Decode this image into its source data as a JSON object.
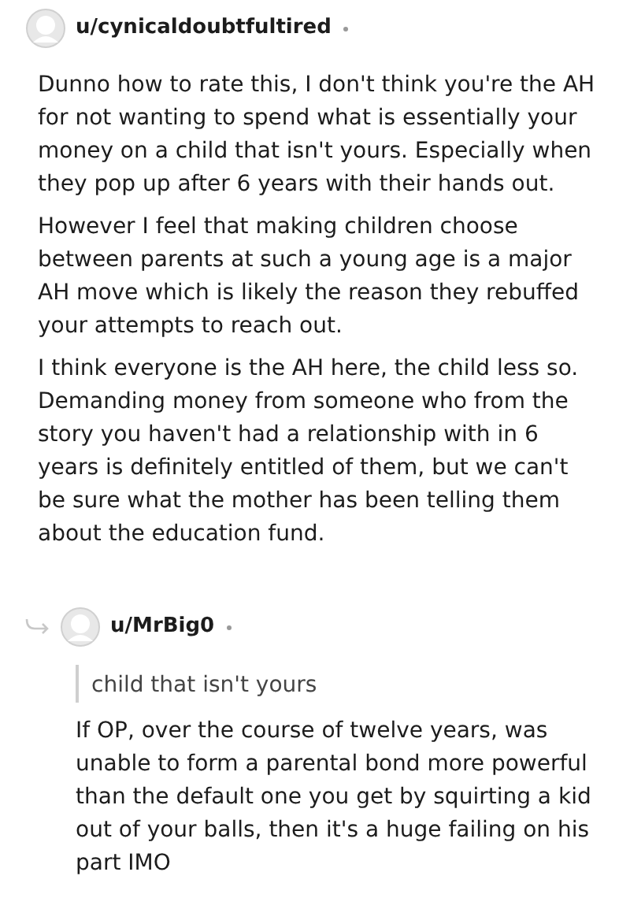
{
  "comment": {
    "author": "u/cynicaldoubtfultired",
    "paragraphs": [
      "Dunno how to rate this, I don't think you're the AH for not wanting to spend what is essentially your money on a child that isn't yours. Especially when they pop up after 6 years with their hands out.",
      "However I feel that making children choose between parents at such a young age is a major AH move which is likely the reason they rebuffed your attempts to reach out.",
      "I think everyone is the AH here, the child less so. Demanding money from someone who from the story you haven't had a relationship with in 6 years is definitely entitled of them, but we can't be sure what the mother has been telling them about the education fund."
    ]
  },
  "reply": {
    "author": "u/MrBig0",
    "quote": "child that isn't yours",
    "paragraphs": [
      "If OP, over the course of twelve years, was unable to form a parental bond more powerful than the default one you get by squirting a kid out of your balls, then it's a huge failing on his part IMO"
    ]
  }
}
